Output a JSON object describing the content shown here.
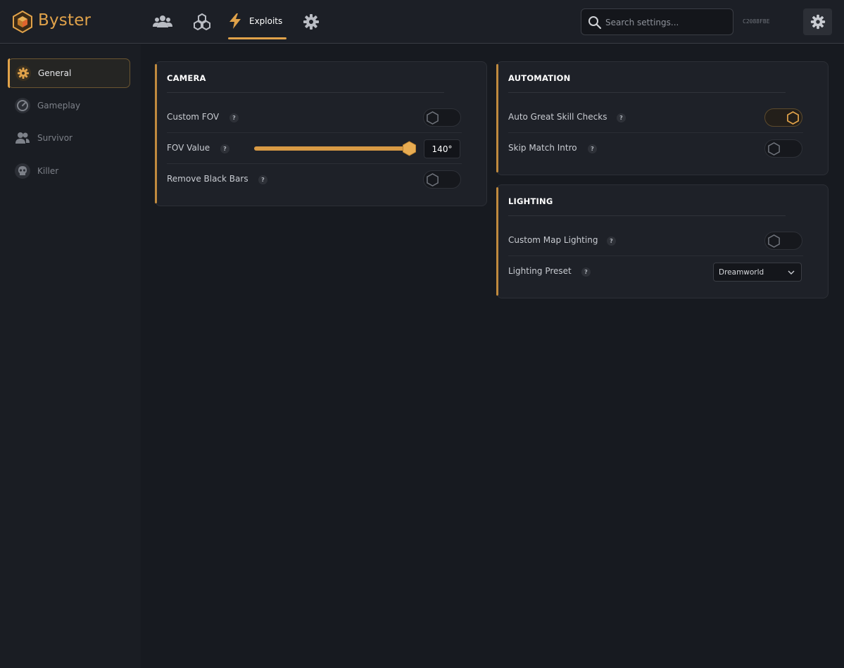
{
  "app": {
    "brand": "Byster",
    "device_code": "C2088FBE",
    "accent": "#e0a24a"
  },
  "nav": {
    "icons": [
      "users-icon",
      "cubes-icon",
      "bolt-icon",
      "gear-icon"
    ],
    "active_tab_label": "Exploits"
  },
  "search": {
    "placeholder": "Search settings..."
  },
  "sidebar": {
    "items": [
      {
        "label": "General",
        "icon": "gear-icon",
        "active": true
      },
      {
        "label": "Gameplay",
        "icon": "gauge-icon",
        "active": false
      },
      {
        "label": "Survivor",
        "icon": "users-icon",
        "active": false
      },
      {
        "label": "Killer",
        "icon": "skull-icon",
        "active": false
      }
    ]
  },
  "camera": {
    "title": "CAMERA",
    "rows": [
      {
        "label": "Custom FOV",
        "type": "toggle",
        "on": false
      },
      {
        "label": "FOV Value",
        "type": "slider",
        "value": "140°",
        "fill_fraction": 1.0
      },
      {
        "label": "Remove Black Bars",
        "type": "toggle",
        "on": false
      }
    ]
  },
  "automation": {
    "title": "AUTOMATION",
    "rows": [
      {
        "label": "Auto Great Skill Checks",
        "type": "toggle",
        "on": true
      },
      {
        "label": "Skip Match Intro",
        "type": "toggle",
        "on": false
      }
    ]
  },
  "lighting": {
    "title": "LIGHTING",
    "rows": [
      {
        "label": "Custom Map Lighting",
        "type": "toggle",
        "on": false
      },
      {
        "label": "Lighting Preset",
        "type": "select",
        "value": "Dreamworld"
      }
    ]
  },
  "help_glyph": "?"
}
